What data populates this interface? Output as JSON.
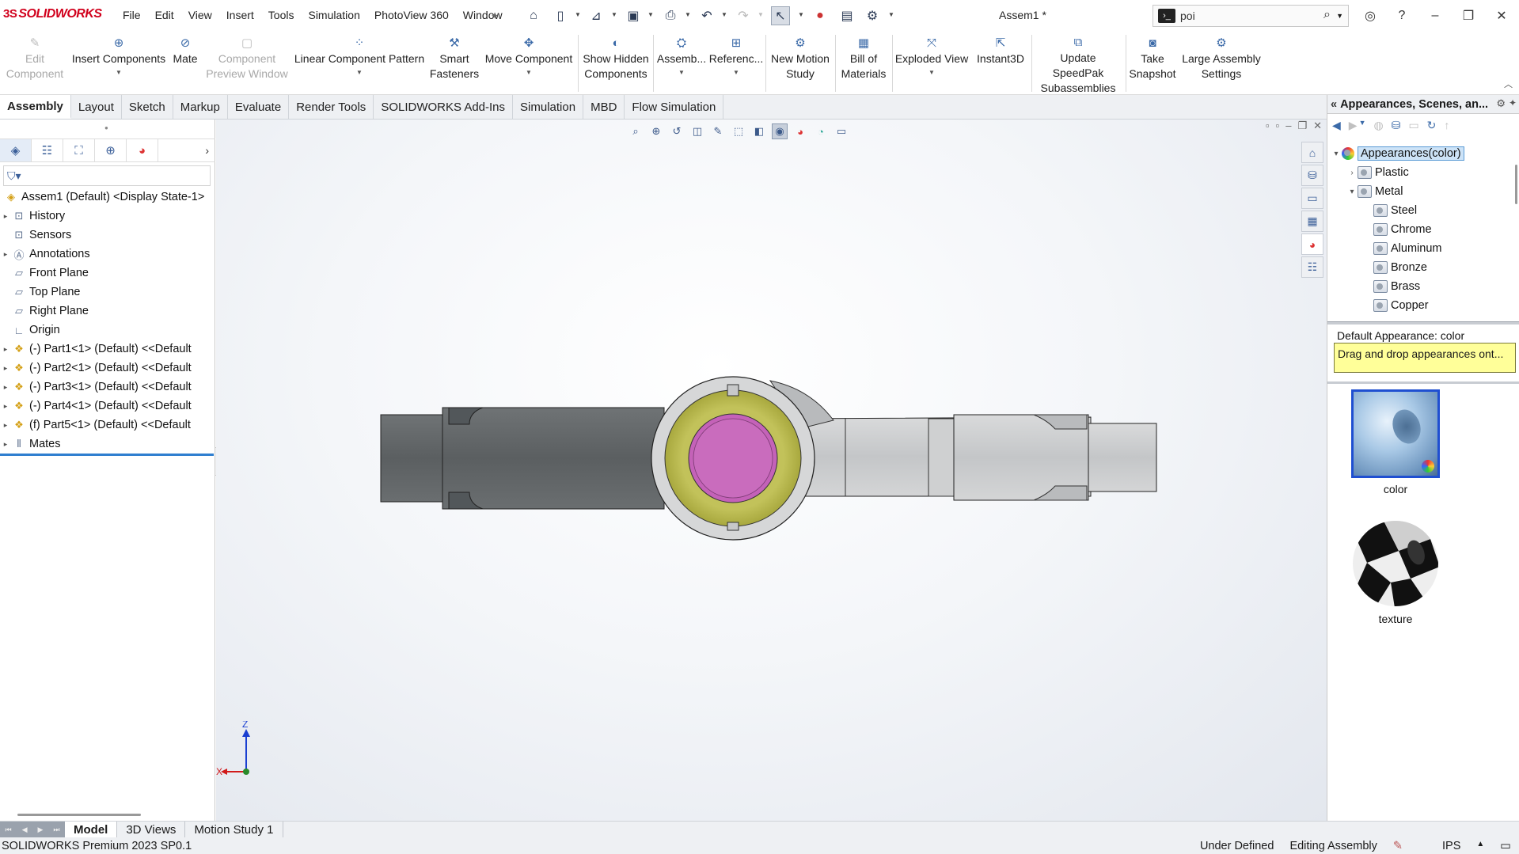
{
  "app": {
    "brand_prefix": "3S",
    "brand_name": "SOLIDWORKS",
    "doc_title": "Assem1 *"
  },
  "menu": [
    "File",
    "Edit",
    "View",
    "Insert",
    "Tools",
    "Simulation",
    "PhotoView 360",
    "Window"
  ],
  "search": {
    "value": "poi"
  },
  "ribbon": {
    "edit_component": [
      "Edit",
      "Component"
    ],
    "insert_components": "Insert Components",
    "mate": "Mate",
    "component_preview": [
      "Component",
      "Preview Window"
    ],
    "linear_pattern": "Linear Component Pattern",
    "smart_fasteners": [
      "Smart",
      "Fasteners"
    ],
    "move_component": "Move Component",
    "show_hidden": [
      "Show Hidden",
      "Components"
    ],
    "assembly": "Assemb...",
    "reference": "Referenc...",
    "motion_study": [
      "New Motion",
      "Study"
    ],
    "bom": [
      "Bill of",
      "Materials"
    ],
    "exploded": "Exploded View",
    "instant3d": "Instant3D",
    "speedpak": [
      "Update SpeedPak",
      "Subassemblies"
    ],
    "snapshot": [
      "Take",
      "Snapshot"
    ],
    "large_assembly": [
      "Large Assembly",
      "Settings"
    ]
  },
  "tabs": [
    "Assembly",
    "Layout",
    "Sketch",
    "Markup",
    "Evaluate",
    "Render Tools",
    "SOLIDWORKS Add-Ins",
    "Simulation",
    "MBD",
    "Flow Simulation"
  ],
  "tree": {
    "root": "Assem1 (Default) <Display State-1>",
    "items": [
      "History",
      "Sensors",
      "Annotations",
      "Front Plane",
      "Top Plane",
      "Right Plane",
      "Origin"
    ],
    "parts": [
      "(-) Part1<1> (Default) <<Default",
      "(-) Part2<1> (Default) <<Default",
      "(-) Part3<1> (Default) <<Default",
      "(-) Part4<1> (Default) <<Default",
      "(f) Part5<1> (Default) <<Default"
    ],
    "mates": "Mates"
  },
  "triad": {
    "z": "Z",
    "x": "X"
  },
  "appearances": {
    "header": "Appearances, Scenes, an...",
    "root": "Appearances(color)",
    "categories": [
      "Plastic",
      "Metal"
    ],
    "metals": [
      "Steel",
      "Chrome",
      "Aluminum",
      "Bronze",
      "Brass",
      "Copper"
    ],
    "default_label": "Default Appearance: color",
    "tip": "Drag and drop appearances ont...",
    "thumbs": [
      "color",
      "texture"
    ]
  },
  "bottom_tabs": [
    "Model",
    "3D Views",
    "Motion Study 1"
  ],
  "status": {
    "product": "SOLIDWORKS Premium 2023 SP0.1",
    "defined": "Under Defined",
    "mode": "Editing Assembly",
    "units": "IPS"
  }
}
